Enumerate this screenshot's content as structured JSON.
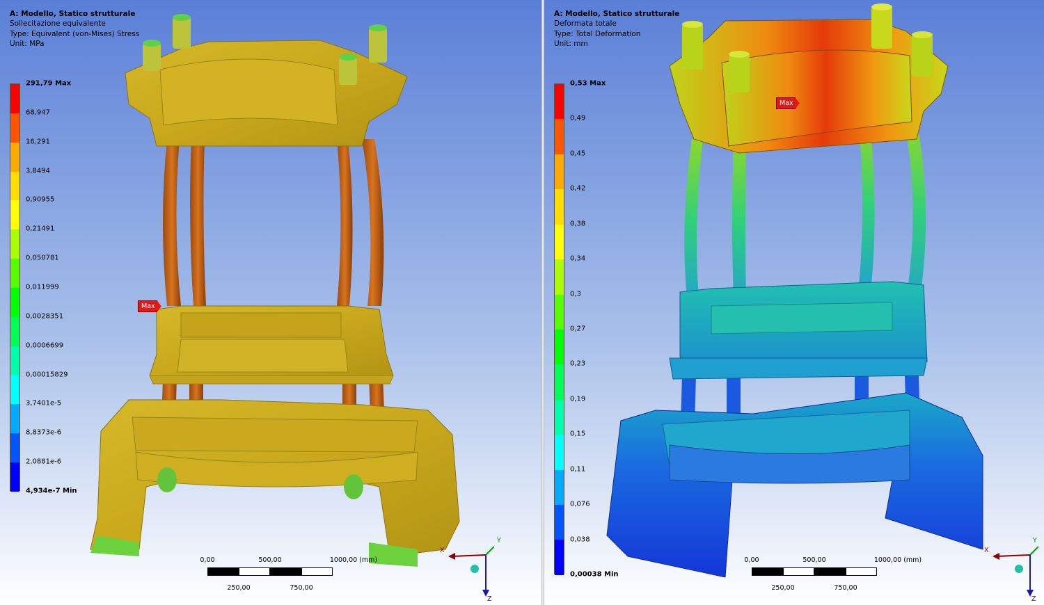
{
  "left_panel": {
    "title": "A: Modello, Statico strutturale",
    "line2": "Sollecitazione equivalente",
    "line3": "Type: Equivalent (von-Mises) Stress",
    "line4": "Unit: MPa",
    "legend_labels": [
      "291,79 Max",
      "68,947",
      "16,291",
      "3,8494",
      "0,90955",
      "0,21491",
      "0,050781",
      "0,011999",
      "0,0028351",
      "0,0006699",
      "0,00015829",
      "3,7401e-5",
      "8,8373e-6",
      "2,0881e-6",
      "4,934e-7 Min"
    ],
    "marker": "Max",
    "scale_top": [
      "0,00",
      "500,00",
      "1000,00 (mm)"
    ],
    "scale_bottom": [
      "250,00",
      "750,00"
    ],
    "axes": {
      "x": "X",
      "y": "Y",
      "z": "Z"
    }
  },
  "right_panel": {
    "title": "A: Modello, Statico strutturale",
    "line2": "Deformata totale",
    "line3": "Type: Total Deformation",
    "line4": "Unit: mm",
    "legend_labels": [
      "0,53 Max",
      "0,49",
      "0,45",
      "0,42",
      "0,38",
      "0,34",
      "0,3",
      "0,27",
      "0,23",
      "0,19",
      "0,15",
      "0,11",
      "0,076",
      "0,038",
      "0,00038 Min"
    ],
    "marker": "Max",
    "scale_top": [
      "0,00",
      "500,00",
      "1000,00 (mm)"
    ],
    "scale_bottom": [
      "250,00",
      "750,00"
    ],
    "axes": {
      "x": "X",
      "y": "Y",
      "z": "Z"
    }
  },
  "colors": {
    "legend_bands": [
      "#ff0000",
      "#ff5500",
      "#ffaa00",
      "#ffdd00",
      "#ffff00",
      "#aaff00",
      "#55ff00",
      "#00ff00",
      "#00ff55",
      "#00ffaa",
      "#00ffff",
      "#00aaff",
      "#0055ff",
      "#0000ff"
    ]
  }
}
